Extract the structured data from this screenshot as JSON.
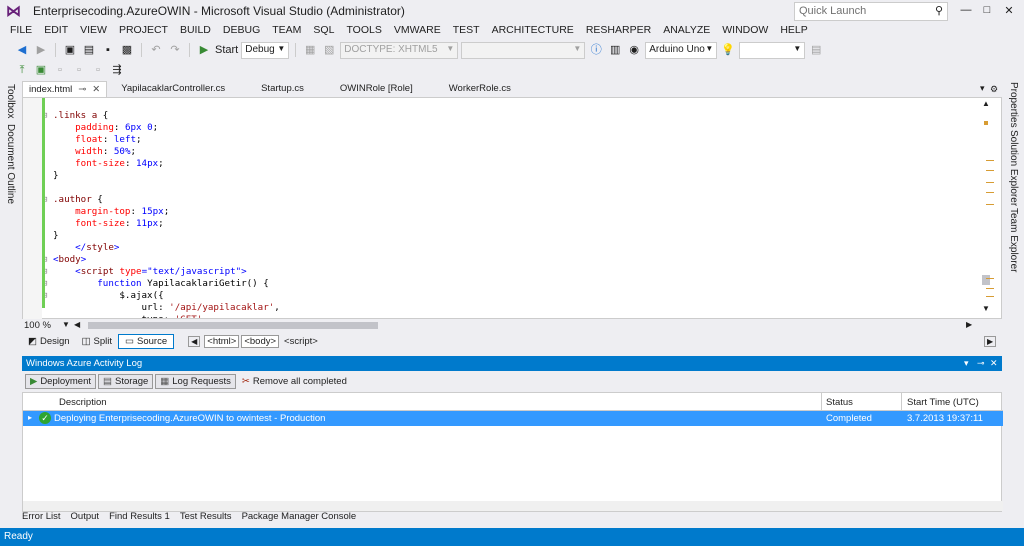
{
  "window": {
    "title": "Enterprisecoding.AzureOWIN - Microsoft Visual Studio (Administrator)",
    "quick_launch_placeholder": "Quick Launch",
    "minimize": "—",
    "maximize": "□",
    "close": "✕"
  },
  "menu": [
    "FILE",
    "EDIT",
    "VIEW",
    "PROJECT",
    "BUILD",
    "DEBUG",
    "TEAM",
    "SQL",
    "TOOLS",
    "VMWARE",
    "TEST",
    "ARCHITECTURE",
    "RESHARPER",
    "ANALYZE",
    "WINDOW",
    "HELP"
  ],
  "toolbar": {
    "start_label": "Start",
    "config_value": "Debug",
    "doctype_value": "DOCTYPE: XHTML5",
    "board_value": "Arduino Uno"
  },
  "left_side": {
    "toolbox": "Toolbox",
    "outline": "Document Outline"
  },
  "right_side": {
    "properties": "Properties",
    "solution": "Solution Explorer",
    "team": "Team Explorer"
  },
  "tabs": [
    "index.html",
    "YapilacaklarController.cs",
    "Startup.cs",
    "OWINRole [Role]",
    "WorkerRole.cs"
  ],
  "code_lines": [
    {
      "g": "",
      "f": "",
      "parts": [
        [
          "txt",
          ""
        ]
      ]
    },
    {
      "g": "to",
      "f": "⊟",
      "parts": [
        [
          "sel",
          ".links a"
        ],
        [
          "txt",
          " {"
        ]
      ]
    },
    {
      "g": "",
      "f": "",
      "parts": [
        [
          "txt",
          "    "
        ],
        [
          "prop",
          "padding"
        ],
        [
          "txt",
          ": "
        ],
        [
          "val",
          "6px 0"
        ],
        [
          "txt",
          ";"
        ]
      ]
    },
    {
      "g": "",
      "f": "",
      "parts": [
        [
          "txt",
          "    "
        ],
        [
          "prop",
          "float"
        ],
        [
          "txt",
          ": "
        ],
        [
          "val",
          "left"
        ],
        [
          "txt",
          ";"
        ]
      ]
    },
    {
      "g": "",
      "f": "",
      "parts": [
        [
          "txt",
          "    "
        ],
        [
          "prop",
          "width"
        ],
        [
          "txt",
          ": "
        ],
        [
          "val",
          "50%"
        ],
        [
          "txt",
          ";"
        ]
      ]
    },
    {
      "g": "",
      "f": "",
      "parts": [
        [
          "txt",
          "    "
        ],
        [
          "prop",
          "font-size"
        ],
        [
          "txt",
          ": "
        ],
        [
          "val",
          "14px"
        ],
        [
          "txt",
          ";"
        ]
      ]
    },
    {
      "g": "",
      "f": "",
      "parts": [
        [
          "txt",
          "}"
        ]
      ]
    },
    {
      "g": "",
      "f": "",
      "parts": [
        [
          "txt",
          ""
        ]
      ]
    },
    {
      "g": "to",
      "f": "⊟",
      "parts": [
        [
          "sel",
          ".author"
        ],
        [
          "txt",
          " {"
        ]
      ]
    },
    {
      "g": "",
      "f": "",
      "parts": [
        [
          "txt",
          "    "
        ],
        [
          "prop",
          "margin-top"
        ],
        [
          "txt",
          ": "
        ],
        [
          "val",
          "15px"
        ],
        [
          "txt",
          ";"
        ]
      ]
    },
    {
      "g": "",
      "f": "",
      "parts": [
        [
          "txt",
          "    "
        ],
        [
          "prop",
          "font-size"
        ],
        [
          "txt",
          ": "
        ],
        [
          "val",
          "11px"
        ],
        [
          "txt",
          ";"
        ]
      ]
    },
    {
      "g": "",
      "f": "",
      "parts": [
        [
          "txt",
          "}"
        ]
      ]
    },
    {
      "g": "",
      "f": "",
      "parts": [
        [
          "txt",
          "    "
        ],
        [
          "ang",
          "</"
        ],
        [
          "tag",
          "style"
        ],
        [
          "ang",
          ">"
        ]
      ]
    },
    {
      "g": "",
      "f": "⊟",
      "parts": [
        [
          "ang",
          "<"
        ],
        [
          "tag",
          "body"
        ],
        [
          "ang",
          ">"
        ]
      ]
    },
    {
      "g": "",
      "f": "⊟",
      "parts": [
        [
          "txt",
          "    "
        ],
        [
          "ang",
          "<"
        ],
        [
          "tag",
          "script"
        ],
        [
          "txt",
          " "
        ],
        [
          "attr",
          "type"
        ],
        [
          "ang",
          "="
        ],
        [
          "ang",
          "\"text/javascript\""
        ],
        [
          "ang",
          ">"
        ]
      ]
    },
    {
      "g": "",
      "f": "⊟",
      "parts": [
        [
          "txt",
          "        "
        ],
        [
          "kw",
          "function"
        ],
        [
          "txt",
          " YapilacaklariGetir() {"
        ]
      ]
    },
    {
      "g": "",
      "f": "⊟",
      "parts": [
        [
          "txt",
          "            $.ajax({"
        ]
      ]
    },
    {
      "g": "",
      "f": "",
      "parts": [
        [
          "txt",
          "                url: "
        ],
        [
          "str",
          "'/api/yapilacaklar'"
        ],
        [
          "txt",
          ","
        ]
      ]
    },
    {
      "g": "",
      "f": "",
      "parts": [
        [
          "txt",
          "                type: "
        ],
        [
          "str",
          "'GET'"
        ],
        [
          "txt",
          ","
        ]
      ]
    }
  ],
  "zoom": "100 %",
  "views": {
    "design": "Design",
    "split": "Split",
    "source": "Source"
  },
  "breadcrumbs": [
    "<html>",
    "<body>",
    "<script>"
  ],
  "panel": {
    "title": "Windows Azure Activity Log",
    "deployment": "Deployment",
    "storage": "Storage",
    "log_requests": "Log Requests",
    "remove_all": "Remove all completed"
  },
  "grid": {
    "headers": {
      "description": "Description",
      "status": "Status",
      "start": "Start Time (UTC)"
    },
    "rows": [
      {
        "description": "Deploying Enterprisecoding.AzureOWIN to owintest - Production",
        "status": "Completed",
        "start": "3.7.2013 19:37:11"
      }
    ]
  },
  "bottom_tabs": [
    "Error List",
    "Output",
    "Find Results 1",
    "Test Results",
    "Package Manager Console"
  ],
  "status": "Ready"
}
